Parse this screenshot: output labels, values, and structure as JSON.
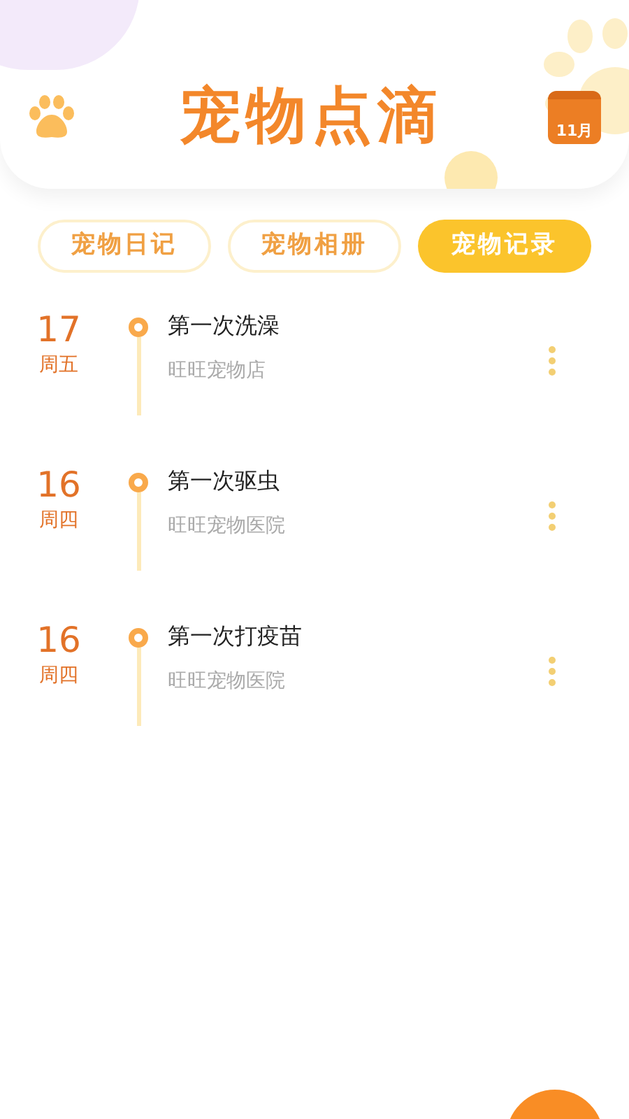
{
  "header": {
    "title": "宠物点滴",
    "calendar_label": "11月"
  },
  "tabs": [
    {
      "label": "宠物日记",
      "selected": false
    },
    {
      "label": "宠物相册",
      "selected": false
    },
    {
      "label": "宠物记录",
      "selected": true
    }
  ],
  "records": [
    {
      "day": "17",
      "weekday": "周五",
      "title": "第一次洗澡",
      "place": "旺旺宠物店"
    },
    {
      "day": "16",
      "weekday": "周四",
      "title": "第一次驱虫",
      "place": "旺旺宠物医院"
    },
    {
      "day": "16",
      "weekday": "周四",
      "title": "第一次打疫苗",
      "place": "旺旺宠物医院"
    }
  ]
}
